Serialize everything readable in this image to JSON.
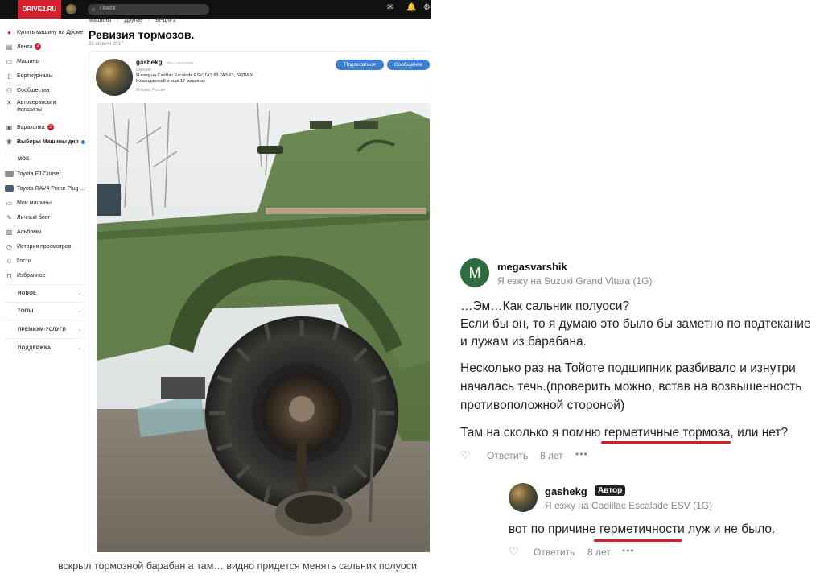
{
  "site": {
    "logo": "DRIVE2.RU",
    "search_placeholder": "Поиск"
  },
  "sidebar": {
    "items": [
      {
        "label": "Купить машину на Дроме",
        "icon": "drom-icon"
      },
      {
        "label": "Лента",
        "icon": "feed-icon",
        "badge": "4"
      },
      {
        "label": "Машины",
        "icon": "car-icon"
      },
      {
        "label": "Бортжурналы",
        "icon": "logbook-icon"
      },
      {
        "label": "Сообщества",
        "icon": "community-icon"
      },
      {
        "label": "Автосервисы и",
        "label2": "магазины",
        "icon": "wrench-icon"
      },
      {
        "label": "Барахолка",
        "icon": "market-icon",
        "badge": "2"
      },
      {
        "label": "Выборы Машины дня",
        "icon": "trophy-icon"
      }
    ],
    "my_heading": "МОЕ",
    "my_items": [
      {
        "label": "Toyota FJ Cruiser"
      },
      {
        "label": "Toyota RAV4 Prime Plug-..."
      },
      {
        "label": "Мои машины"
      },
      {
        "label": "Личный блог"
      },
      {
        "label": "Альбомы"
      },
      {
        "label": "История просмотров"
      },
      {
        "label": "Гости"
      },
      {
        "label": "Избранное"
      }
    ],
    "sections": [
      "НОВОЕ",
      "ТОПЫ",
      "ПРЕМИУМ-УСЛУГИ",
      "ПОДДЕРЖКА"
    ]
  },
  "post": {
    "breadcrumb": [
      "Машины",
      "›",
      "Другие",
      "›",
      "БРДМ-2"
    ],
    "title": "Ревизия тормозов.",
    "date": "23 апреля 2017",
    "author": {
      "name": "gashekg",
      "time": "был 3 часа назад",
      "real_name": "Евгений",
      "cars": "Я езжу на Cadillac Escalade ESV, ГАЗ 63 ГАЗ-63, БРДМ-У Командирский и ещё 17 машинах",
      "city": "Москва, Россия"
    },
    "subscribe_label": "Подписаться",
    "message_label": "Сообщение",
    "caption": "вскрыл тормозной барабан а там… видно придется менять сальник полуоси"
  },
  "comments": [
    {
      "avatar_letter": "M",
      "avatar_color": "#2e6b3e",
      "name": "megasvarshik",
      "sub": "Я езжу на Suzuki Grand Vitara (1G)",
      "lines": [
        "…Эм…Как сальник полуоси?",
        "Если бы он, то я думаю это было бы заметно по подтекание",
        "и лужам из барабана.",
        "Несколько раз на Тойоте подшипник разбивало и изнутри",
        "началась течь.(проверить можно, встав на возвышенность",
        "противоположной стороной)",
        "Там на сколько я помню герметичные тормоза, или нет?"
      ],
      "reply_label": "Ответить",
      "age": "8 лет",
      "more": "•••"
    },
    {
      "name": "gashekg",
      "badge": "Автор",
      "sub": "Я езжу на Cadillac Escalade ESV (1G)",
      "lines": [
        "вот по причине герметичности луж и не было."
      ],
      "reply_label": "Ответить",
      "age": "8 лет",
      "more": "•••"
    }
  ],
  "colors": {
    "brand": "#d5202e",
    "button": "#3f7fd0",
    "underline": "#d0202a"
  }
}
